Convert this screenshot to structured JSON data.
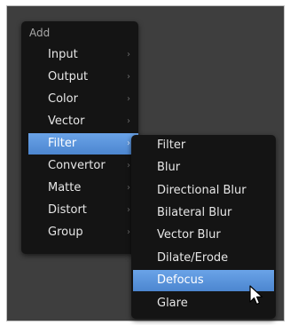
{
  "main_menu": {
    "title": "Add",
    "items": [
      {
        "label": "Input"
      },
      {
        "label": "Output"
      },
      {
        "label": "Color"
      },
      {
        "label": "Vector"
      },
      {
        "label": "Filter"
      },
      {
        "label": "Convertor"
      },
      {
        "label": "Matte"
      },
      {
        "label": "Distort"
      },
      {
        "label": "Group"
      }
    ],
    "active_item": "Filter",
    "arrow_glyph": "›"
  },
  "sub_menu": {
    "items": [
      {
        "label": "Filter"
      },
      {
        "label": "Blur"
      },
      {
        "label": "Directional Blur"
      },
      {
        "label": "Bilateral Blur"
      },
      {
        "label": "Vector Blur"
      },
      {
        "label": "Dilate/Erode"
      },
      {
        "label": "Defocus"
      },
      {
        "label": "Glare"
      }
    ],
    "active_item": "Defocus"
  },
  "colors": {
    "menu_bg": "#141414",
    "highlight": "#5b95dd",
    "canvas_bg": "#3e3e3e",
    "text": "#e6e6e6"
  },
  "icons": {
    "submenu": "chevron-right-icon",
    "cursor": "mouse-pointer-icon"
  }
}
